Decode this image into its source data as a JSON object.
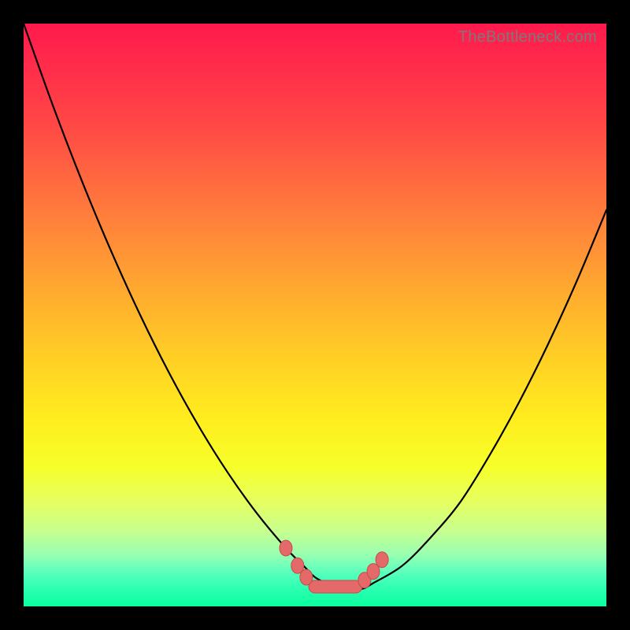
{
  "watermark": "TheBottleneck.com",
  "chart_data": {
    "type": "line",
    "title": "",
    "xlabel": "",
    "ylabel": "",
    "x_range": [
      0,
      100
    ],
    "y_range_percent": [
      0,
      100
    ],
    "curve": {
      "description": "V-shaped bottleneck curve; high (red/bad) at extremes, near-zero (green/good) around center-right valley",
      "x": [
        0,
        5,
        10,
        15,
        20,
        25,
        30,
        35,
        40,
        45,
        48,
        50,
        52,
        55,
        58,
        60,
        65,
        70,
        75,
        80,
        85,
        90,
        95,
        100
      ],
      "y_percent_from_top": [
        0,
        14,
        27,
        39,
        50,
        60,
        69,
        77,
        84,
        90,
        93,
        95,
        96,
        97,
        97,
        96,
        93,
        88,
        82,
        74,
        65,
        55,
        44,
        32
      ]
    },
    "markers": {
      "description": "Highlighted points near the valley bottom (optimal, green zone)",
      "points": [
        {
          "x": 45,
          "y_percent_from_top": 90
        },
        {
          "x": 47,
          "y_percent_from_top": 93
        },
        {
          "x": 48.5,
          "y_percent_from_top": 95
        },
        {
          "x": 50,
          "y_percent_from_top": 96
        },
        {
          "x": 52,
          "y_percent_from_top": 97
        },
        {
          "x": 55,
          "y_percent_from_top": 97
        },
        {
          "x": 57,
          "y_percent_from_top": 96.5
        },
        {
          "x": 58.5,
          "y_percent_from_top": 95.5
        },
        {
          "x": 60,
          "y_percent_from_top": 94
        },
        {
          "x": 61.5,
          "y_percent_from_top": 92
        }
      ],
      "color": "#e46a6a"
    },
    "gradient_meaning": "top (red) = high bottleneck, bottom (green) = low/no bottleneck"
  }
}
